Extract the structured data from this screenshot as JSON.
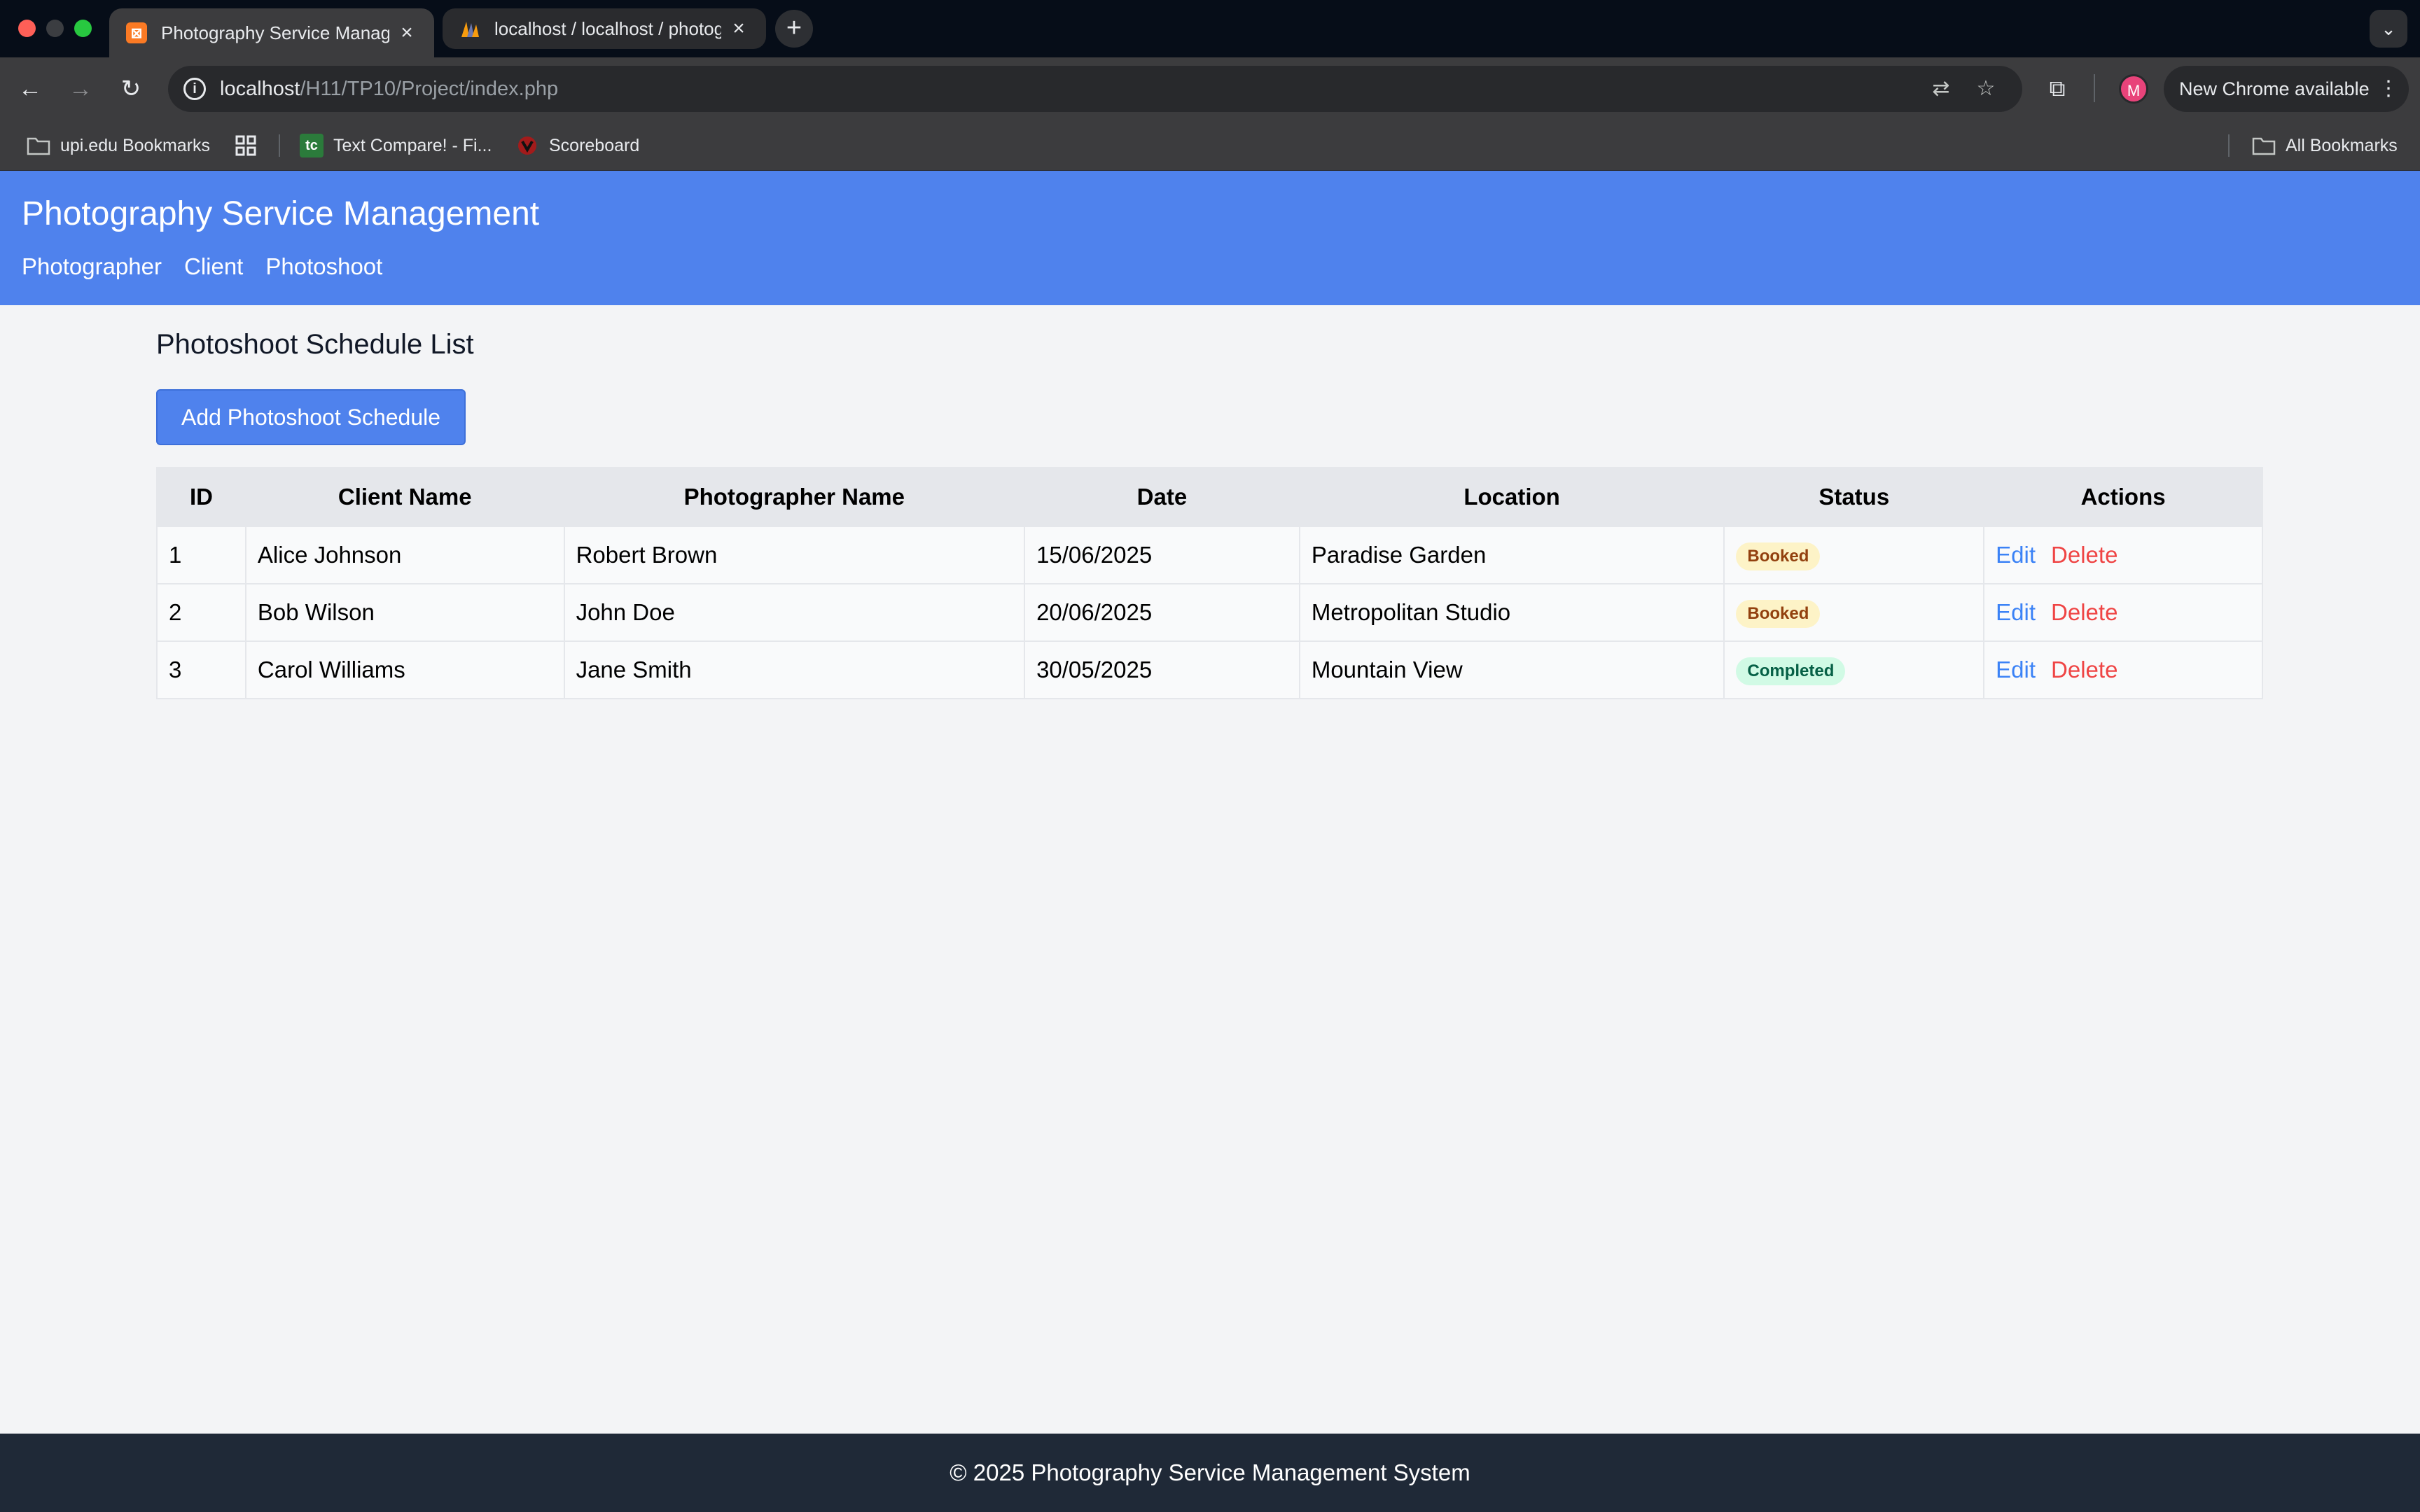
{
  "browser": {
    "tabs": [
      {
        "title": "Photography Service Manage",
        "favicon": "xampp-icon",
        "active": true
      },
      {
        "title": "localhost / localhost / photogr",
        "favicon": "phpmyadmin-icon",
        "active": false
      }
    ],
    "url_host": "localhost",
    "url_path": "/H11/TP10/Project/index.php",
    "profile_initial": "M",
    "update_label": "New Chrome available",
    "bookmarks": [
      {
        "label": "upi.edu Bookmarks",
        "icon": "managed-folder-icon"
      },
      {
        "label": "Text Compare! - Fi...",
        "icon": "textcompare-icon"
      },
      {
        "label": "Scoreboard",
        "icon": "scoreboard-icon"
      }
    ],
    "all_bookmarks_label": "All Bookmarks"
  },
  "site": {
    "title": "Photography Service Management",
    "nav": [
      "Photographer",
      "Client",
      "Photoshoot"
    ]
  },
  "main": {
    "heading": "Photoshoot Schedule List",
    "add_button": "Add Photoshoot Schedule",
    "table": {
      "headers": [
        "ID",
        "Client Name",
        "Photographer Name",
        "Date",
        "Location",
        "Status",
        "Actions"
      ],
      "rows": [
        {
          "id": "1",
          "client": "Alice Johnson",
          "photographer": "Robert Brown",
          "date": "15/06/2025",
          "location": "Paradise Garden",
          "status": "Booked"
        },
        {
          "id": "2",
          "client": "Bob Wilson",
          "photographer": "John Doe",
          "date": "20/06/2025",
          "location": "Metropolitan Studio",
          "status": "Booked"
        },
        {
          "id": "3",
          "client": "Carol Williams",
          "photographer": "Jane Smith",
          "date": "30/05/2025",
          "location": "Mountain View",
          "status": "Completed"
        }
      ],
      "edit_label": "Edit",
      "delete_label": "Delete"
    }
  },
  "footer": {
    "text": "© 2025 Photography Service Management System"
  },
  "colors": {
    "header_bg": "#4f82ed",
    "booked_badge": "#fdf3c7",
    "completed_badge": "#d1fae5",
    "edit_link": "#3b82f6",
    "delete_link": "#ef4444",
    "footer_bg": "#1f2937"
  }
}
